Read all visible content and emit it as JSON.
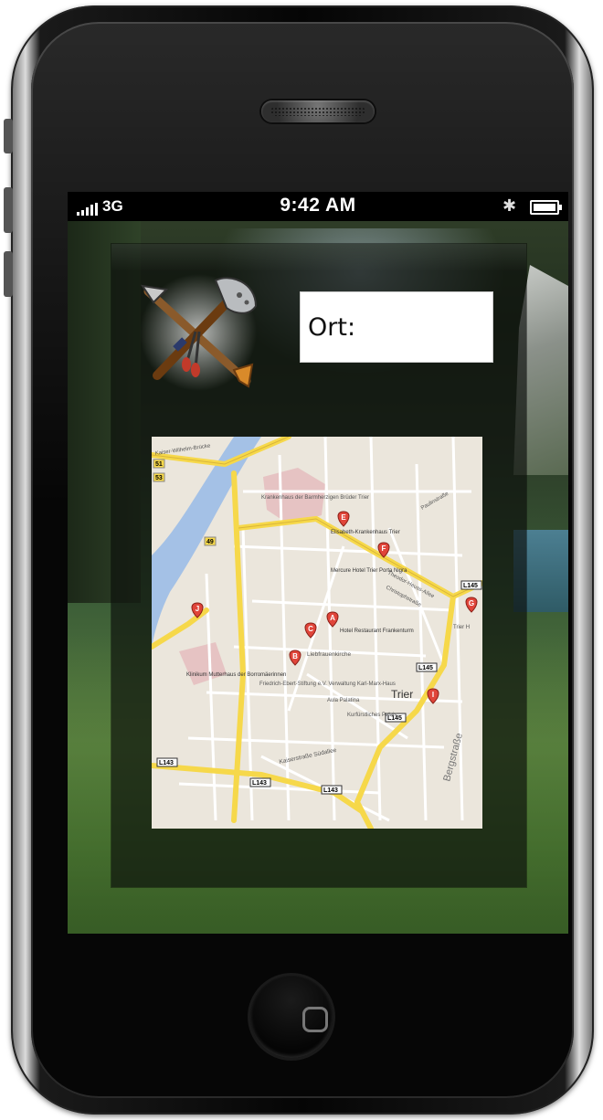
{
  "status_bar": {
    "carrier": "3G",
    "time": "9:42 AM",
    "bluetooth_icon": "bluetooth-icon",
    "battery_icon": "battery-icon",
    "signal_icon": "signal-bars-icon"
  },
  "form": {
    "ort_label": "Ort:"
  },
  "logo": {
    "icon": "crossed-axe-arrow-icon"
  },
  "map": {
    "city_label": "Trier",
    "markers": [
      {
        "letter": "A",
        "label": "Hotel Restaurant Frankenturm"
      },
      {
        "letter": "B",
        "label": ""
      },
      {
        "letter": "C",
        "label": ""
      },
      {
        "letter": "E",
        "label": "Elisabeth-Krankenhaus Trier"
      },
      {
        "letter": "F",
        "label": "Mercure Hotel Trier Porta Nigra"
      },
      {
        "letter": "G",
        "label": ""
      },
      {
        "letter": "I",
        "label": ""
      },
      {
        "letter": "J",
        "label": "Klinikum Mutterhaus der Borromäerinnen"
      }
    ],
    "street_labels": {
      "bergstrasse": "Bergstraße",
      "liebfrauenkirche": "Liebfrauenkirche",
      "aula_palatina": "Aula Palatina",
      "kurfuerstliches_palais": "Kurfürstliches Palais",
      "krankenhaus_barmherzigen": "Krankenhaus der Barmherzigen Brüder Trier",
      "friedrich_ebert": "Friedrich-Ebert-Stiftung e.V. Verwaltung Karl-Marx-Haus",
      "kaiserstrasse": "Kaiserstraße Südallee",
      "l143": "L143",
      "l145": "L145",
      "b49": "49",
      "b51": "51",
      "b53": "53",
      "trier_h": "Trier H",
      "theodor_heuss": "Theodor-Heuss-Allee",
      "christophstrasse": "Christophstraße",
      "paulinstrasse": "Paulinstraße",
      "kaiser_wilhelm_bruecke": "Kaiser-Wilhelm-Brücke"
    }
  },
  "colors": {
    "map_bg": "#ebe6dc",
    "map_major_road": "#f6d84a",
    "map_road": "#ffffff",
    "map_river": "#a4c1e6",
    "marker": "#e0453a"
  }
}
